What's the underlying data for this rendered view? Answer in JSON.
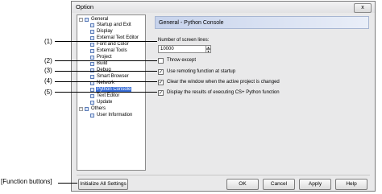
{
  "window": {
    "title": "Option",
    "close_label": "x"
  },
  "callouts": {
    "c1": "(1)",
    "c2": "(2)",
    "c3": "(3)",
    "c4": "(4)",
    "c5": "(5)",
    "function_buttons": "[Function buttons]"
  },
  "tree": {
    "general": "General",
    "items": [
      "Startup and Exit",
      "Display",
      "External Text Editor",
      "Font and Color",
      "External Tools",
      "Project",
      "Build",
      "Debug",
      "Smart Browser",
      "Network",
      "Python Console",
      "Text Editor",
      "Update"
    ],
    "selected": "Python Console",
    "others": "Others",
    "others_items": [
      "User Information"
    ]
  },
  "panel": {
    "header": "General - Python Console",
    "screen_lines_label": "Number of screen lines:",
    "screen_lines_value": "10000",
    "throw_except": "Throw except",
    "use_remoting": "Use remoting function at startup",
    "clear_window": "Clear the window when the active project is changed",
    "display_results": "Display the results of executing CS+ Python function",
    "checks": {
      "throw_except": false,
      "use_remoting": true,
      "clear_window": true,
      "display_results": true
    }
  },
  "buttons": {
    "initialize": "Initialize All Settings",
    "ok": "OK",
    "cancel": "Cancel",
    "apply": "Apply",
    "help": "Help"
  }
}
